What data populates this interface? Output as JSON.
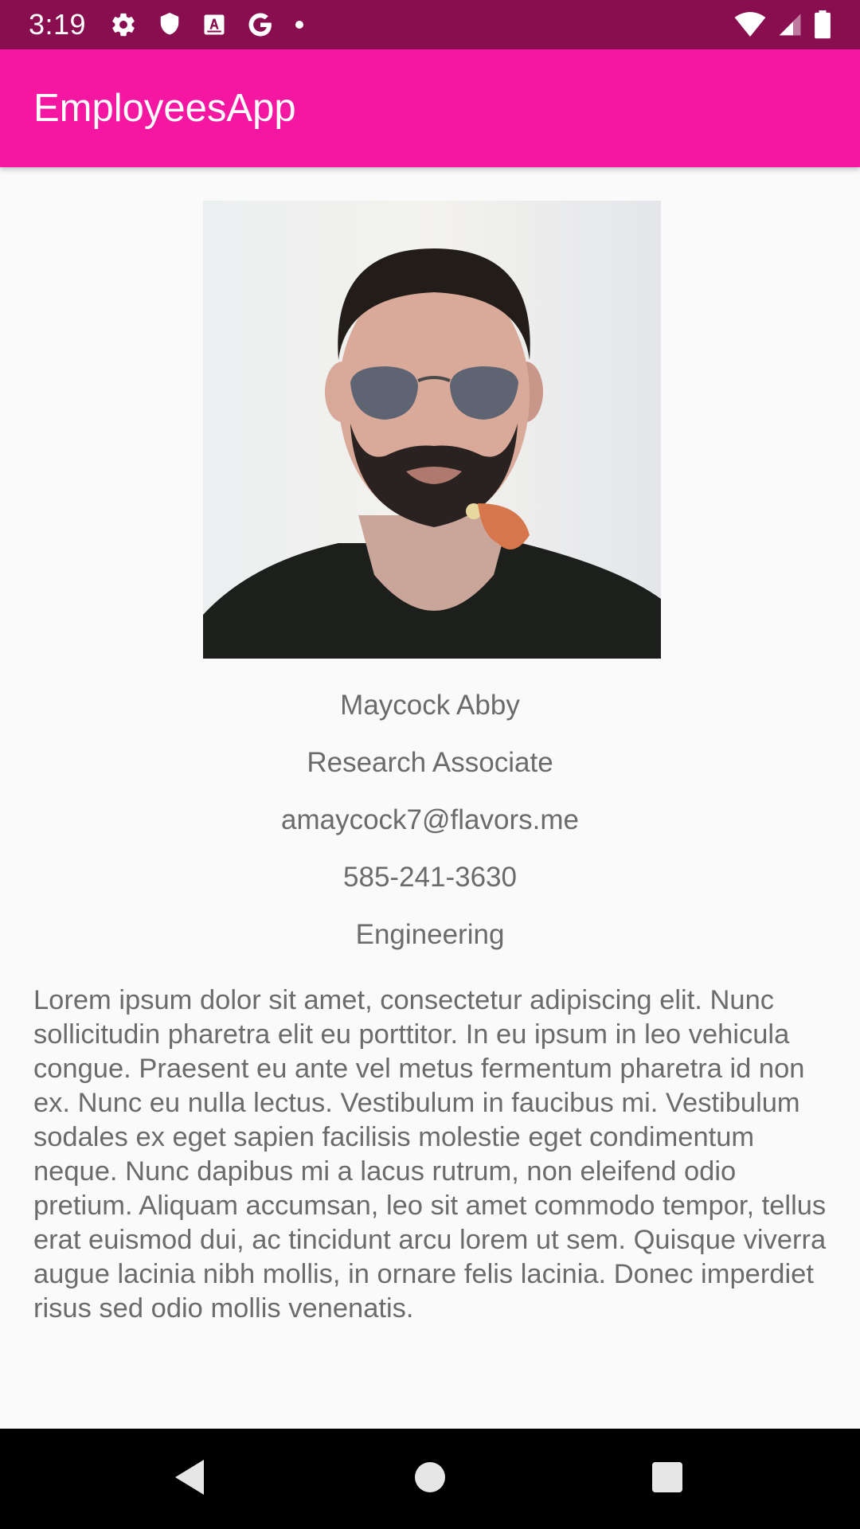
{
  "status_bar": {
    "time": "3:19",
    "left_icons": [
      "gear-icon",
      "shield-icon",
      "font-icon",
      "google-icon",
      "dot-icon"
    ],
    "right_icons": [
      "wifi-icon",
      "signal-icon",
      "battery-icon"
    ]
  },
  "app_bar": {
    "title": "EmployeesApp",
    "color": "#f516a1"
  },
  "employee": {
    "name": "Maycock Abby",
    "title": "Research Associate",
    "email": "amaycock7@flavors.me",
    "phone": "585-241-3630",
    "department": "Engineering",
    "bio": "Lorem ipsum dolor sit amet, consectetur adipiscing elit. Nunc sollicitudin pharetra elit eu porttitor. In eu ipsum in leo vehicula congue. Praesent eu ante vel metus fermentum pharetra id non ex. Nunc eu nulla lectus. Vestibulum in faucibus mi. Vestibulum sodales ex eget sapien facilisis molestie eget condimentum neque. Nunc dapibus mi a lacus rutrum, non eleifend odio pretium. Aliquam accumsan, leo sit amet commodo tempor, tellus erat euismod dui, ac tincidunt arcu lorem ut sem. Quisque viverra augue lacinia nibh mollis, in ornare felis lacinia. Donec imperdiet risus sed odio mollis venenatis."
  },
  "nav_bar": {
    "buttons": [
      "back-icon",
      "home-icon",
      "recents-icon"
    ]
  },
  "colors": {
    "status_bar": "#880e4f",
    "app_bar": "#f516a1",
    "background": "#fafafa",
    "text": "#6b6b6b"
  }
}
